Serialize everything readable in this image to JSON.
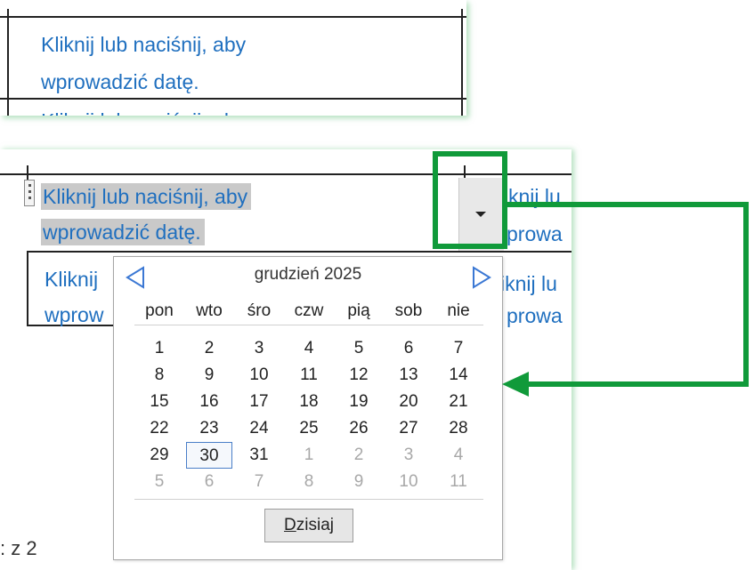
{
  "top_cell": {
    "line1": "Kliknij lub naciśnij, aby",
    "line2": "wprowadzić datę.",
    "cut_line": "Kliknij lub naciśnij, aby"
  },
  "date_field": {
    "line1": "Kliknij lub naciśnij, aby",
    "line2": "wprowadzić datę.",
    "side_line1": "knij lu",
    "side_line2": "prowa"
  },
  "lower_cell": {
    "line1": "Kliknij",
    "line2": "wprow",
    "side_line1": "iknij lu",
    "side_line2": "prowa"
  },
  "status_bar": {
    "page_label": ": z 2"
  },
  "calendar": {
    "month_title": "grudzień 2025",
    "weekdays": [
      "pon",
      "wto",
      "śro",
      "czw",
      "pią",
      "sob",
      "nie"
    ],
    "weeks": [
      [
        "",
        "",
        "",
        "",
        "",
        "",
        ""
      ],
      [
        "1",
        "2",
        "3",
        "4",
        "5",
        "6",
        "7"
      ],
      [
        "8",
        "9",
        "10",
        "11",
        "12",
        "13",
        "14"
      ],
      [
        "15",
        "16",
        "17",
        "18",
        "19",
        "20",
        "21"
      ],
      [
        "22",
        "23",
        "24",
        "25",
        "26",
        "27",
        "28"
      ],
      [
        "29",
        "30",
        "31",
        "1",
        "2",
        "3",
        "4"
      ],
      [
        "5",
        "6",
        "7",
        "8",
        "9",
        "10",
        "11"
      ]
    ],
    "today_button": {
      "underlined": "D",
      "rest": "zisiaj"
    }
  },
  "colors": {
    "link_text": "#1f6fbf",
    "highlight_green": "#109a3a",
    "today_border": "#4a7fc8"
  }
}
